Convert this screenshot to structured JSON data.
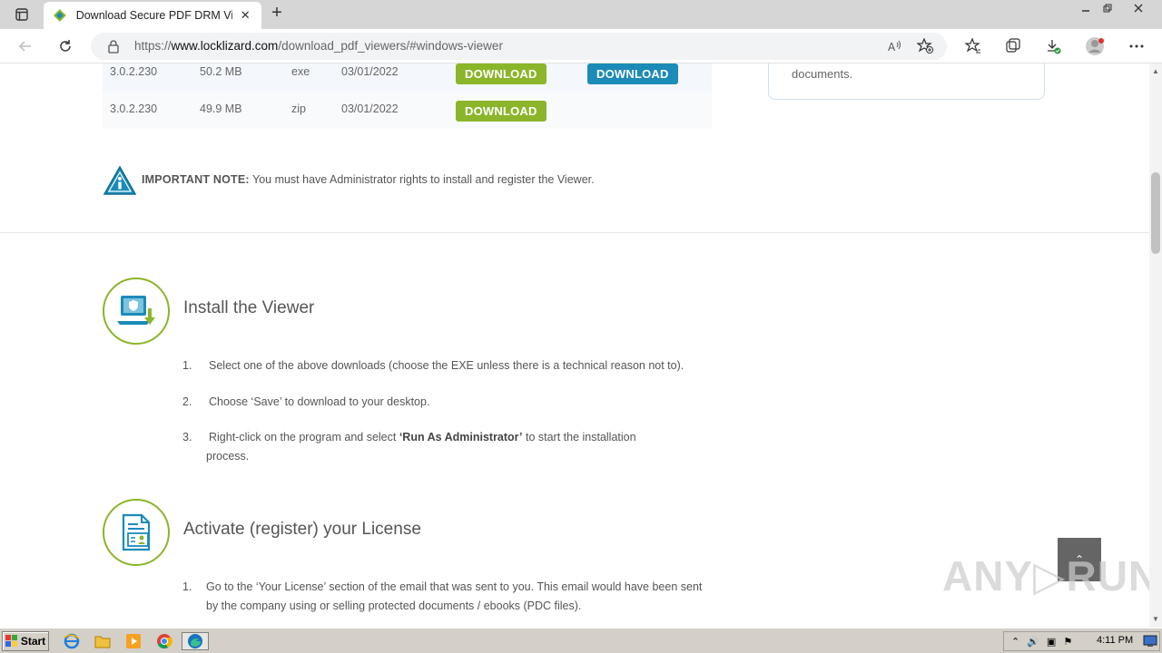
{
  "browser": {
    "tab_title": "Download Secure PDF DRM Viewer",
    "new_tab_symbol": "+",
    "close_symbol": "✕",
    "url_prefix": "https://",
    "url_host": "www.locklizard.com",
    "url_path": "/download_pdf_viewers/#windows-viewer"
  },
  "downloads": {
    "rows": [
      {
        "version": "3.0.2.230",
        "size": "50.2 MB",
        "type": "exe",
        "date": "03/01/2022",
        "green_button": "DOWNLOAD",
        "blue_button": "DOWNLOAD"
      },
      {
        "version": "3.0.2.230",
        "size": "49.9 MB",
        "type": "zip",
        "date": "03/01/2022",
        "green_button": "DOWNLOAD"
      }
    ]
  },
  "side_card": {
    "text": "documents."
  },
  "note": {
    "label": "IMPORTANT NOTE:",
    "text": "You must have Administrator rights to install and register the Viewer."
  },
  "install": {
    "title": "Install the Viewer",
    "steps": [
      {
        "num": "1.",
        "text": "Select one of the above downloads (choose the EXE unless there is a technical reason not to)."
      },
      {
        "num": "2.",
        "text": "Choose ‘Save’ to download to your desktop."
      },
      {
        "num": "3.",
        "pre": "Right-click on the program and select ",
        "bold": "‘Run As Administrator’",
        "post": " to start the installation process."
      }
    ]
  },
  "activate": {
    "title": "Activate (register) your License",
    "steps": [
      {
        "num": "1.",
        "text": "Go to the ‘Your License’ section of the email that was sent to you.  This email would have been sent by the company using or selling protected documents / ebooks (PDC files)."
      }
    ]
  },
  "scroll_top_symbol": "⌃",
  "watermark": "ANY▷RUN",
  "taskbar": {
    "start_label": "Start",
    "clock": "4:11 PM"
  },
  "colors": {
    "green": "#8bb52a",
    "blue": "#1b8bb8"
  }
}
